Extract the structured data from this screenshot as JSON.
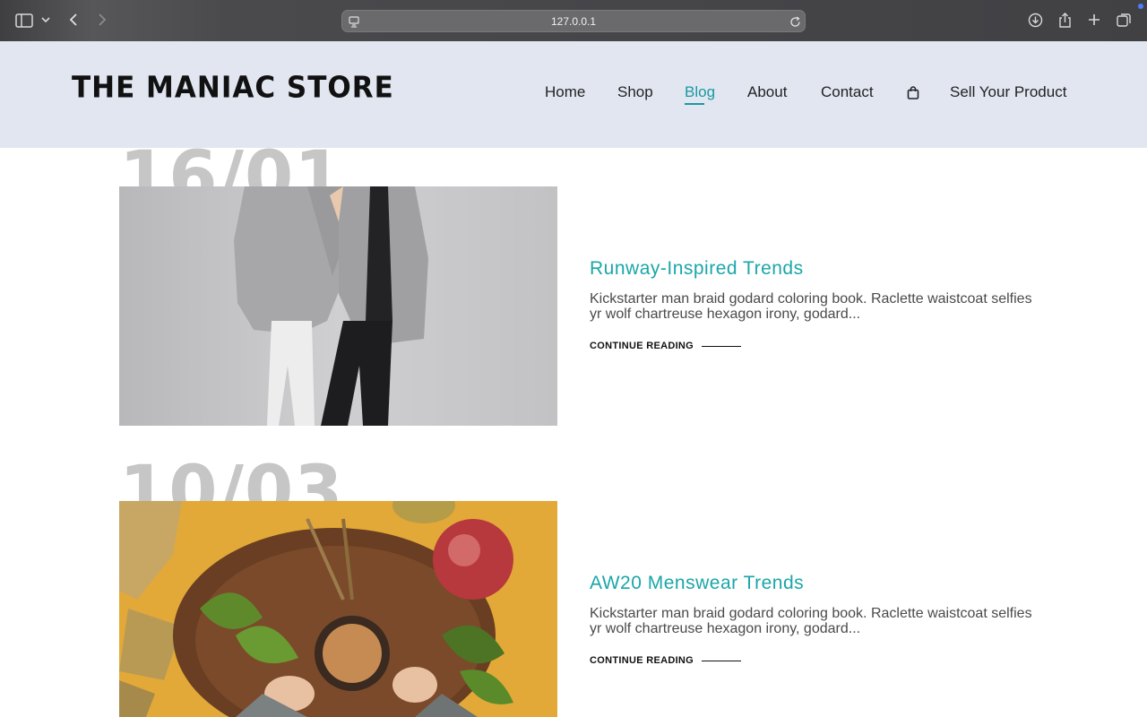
{
  "browser": {
    "url": "127.0.0.1",
    "icons": [
      "sidebar-icon",
      "chevron-down-icon",
      "back-icon",
      "forward-icon",
      "site-settings-icon",
      "reload-icon",
      "download-icon",
      "share-icon",
      "new-tab-icon",
      "tabs-overview-icon"
    ]
  },
  "header": {
    "logo": "THE MANIAC STORE",
    "nav": [
      {
        "label": "Home"
      },
      {
        "label": "Shop"
      },
      {
        "label": "Blog",
        "active": true
      },
      {
        "label": "About"
      },
      {
        "label": "Contact"
      },
      {
        "label": "Sell Your Product"
      }
    ],
    "accent_color": "#1a9aa0",
    "cart_icon": "shopping-bag-icon"
  },
  "posts": [
    {
      "date": "16/01",
      "title": "Runway-Inspired Trends",
      "excerpt": "Kickstarter man braid godard coloring book. Raclette waistcoat selfies yr wolf chartreuse hexagon irony, godard...",
      "cta": "CONTINUE READING"
    },
    {
      "date": "10/03",
      "title": "AW20 Menswear Trends",
      "excerpt": "Kickstarter man braid godard coloring book. Raclette waistcoat selfies yr wolf chartreuse hexagon irony, godard...",
      "cta": "CONTINUE READING"
    }
  ]
}
